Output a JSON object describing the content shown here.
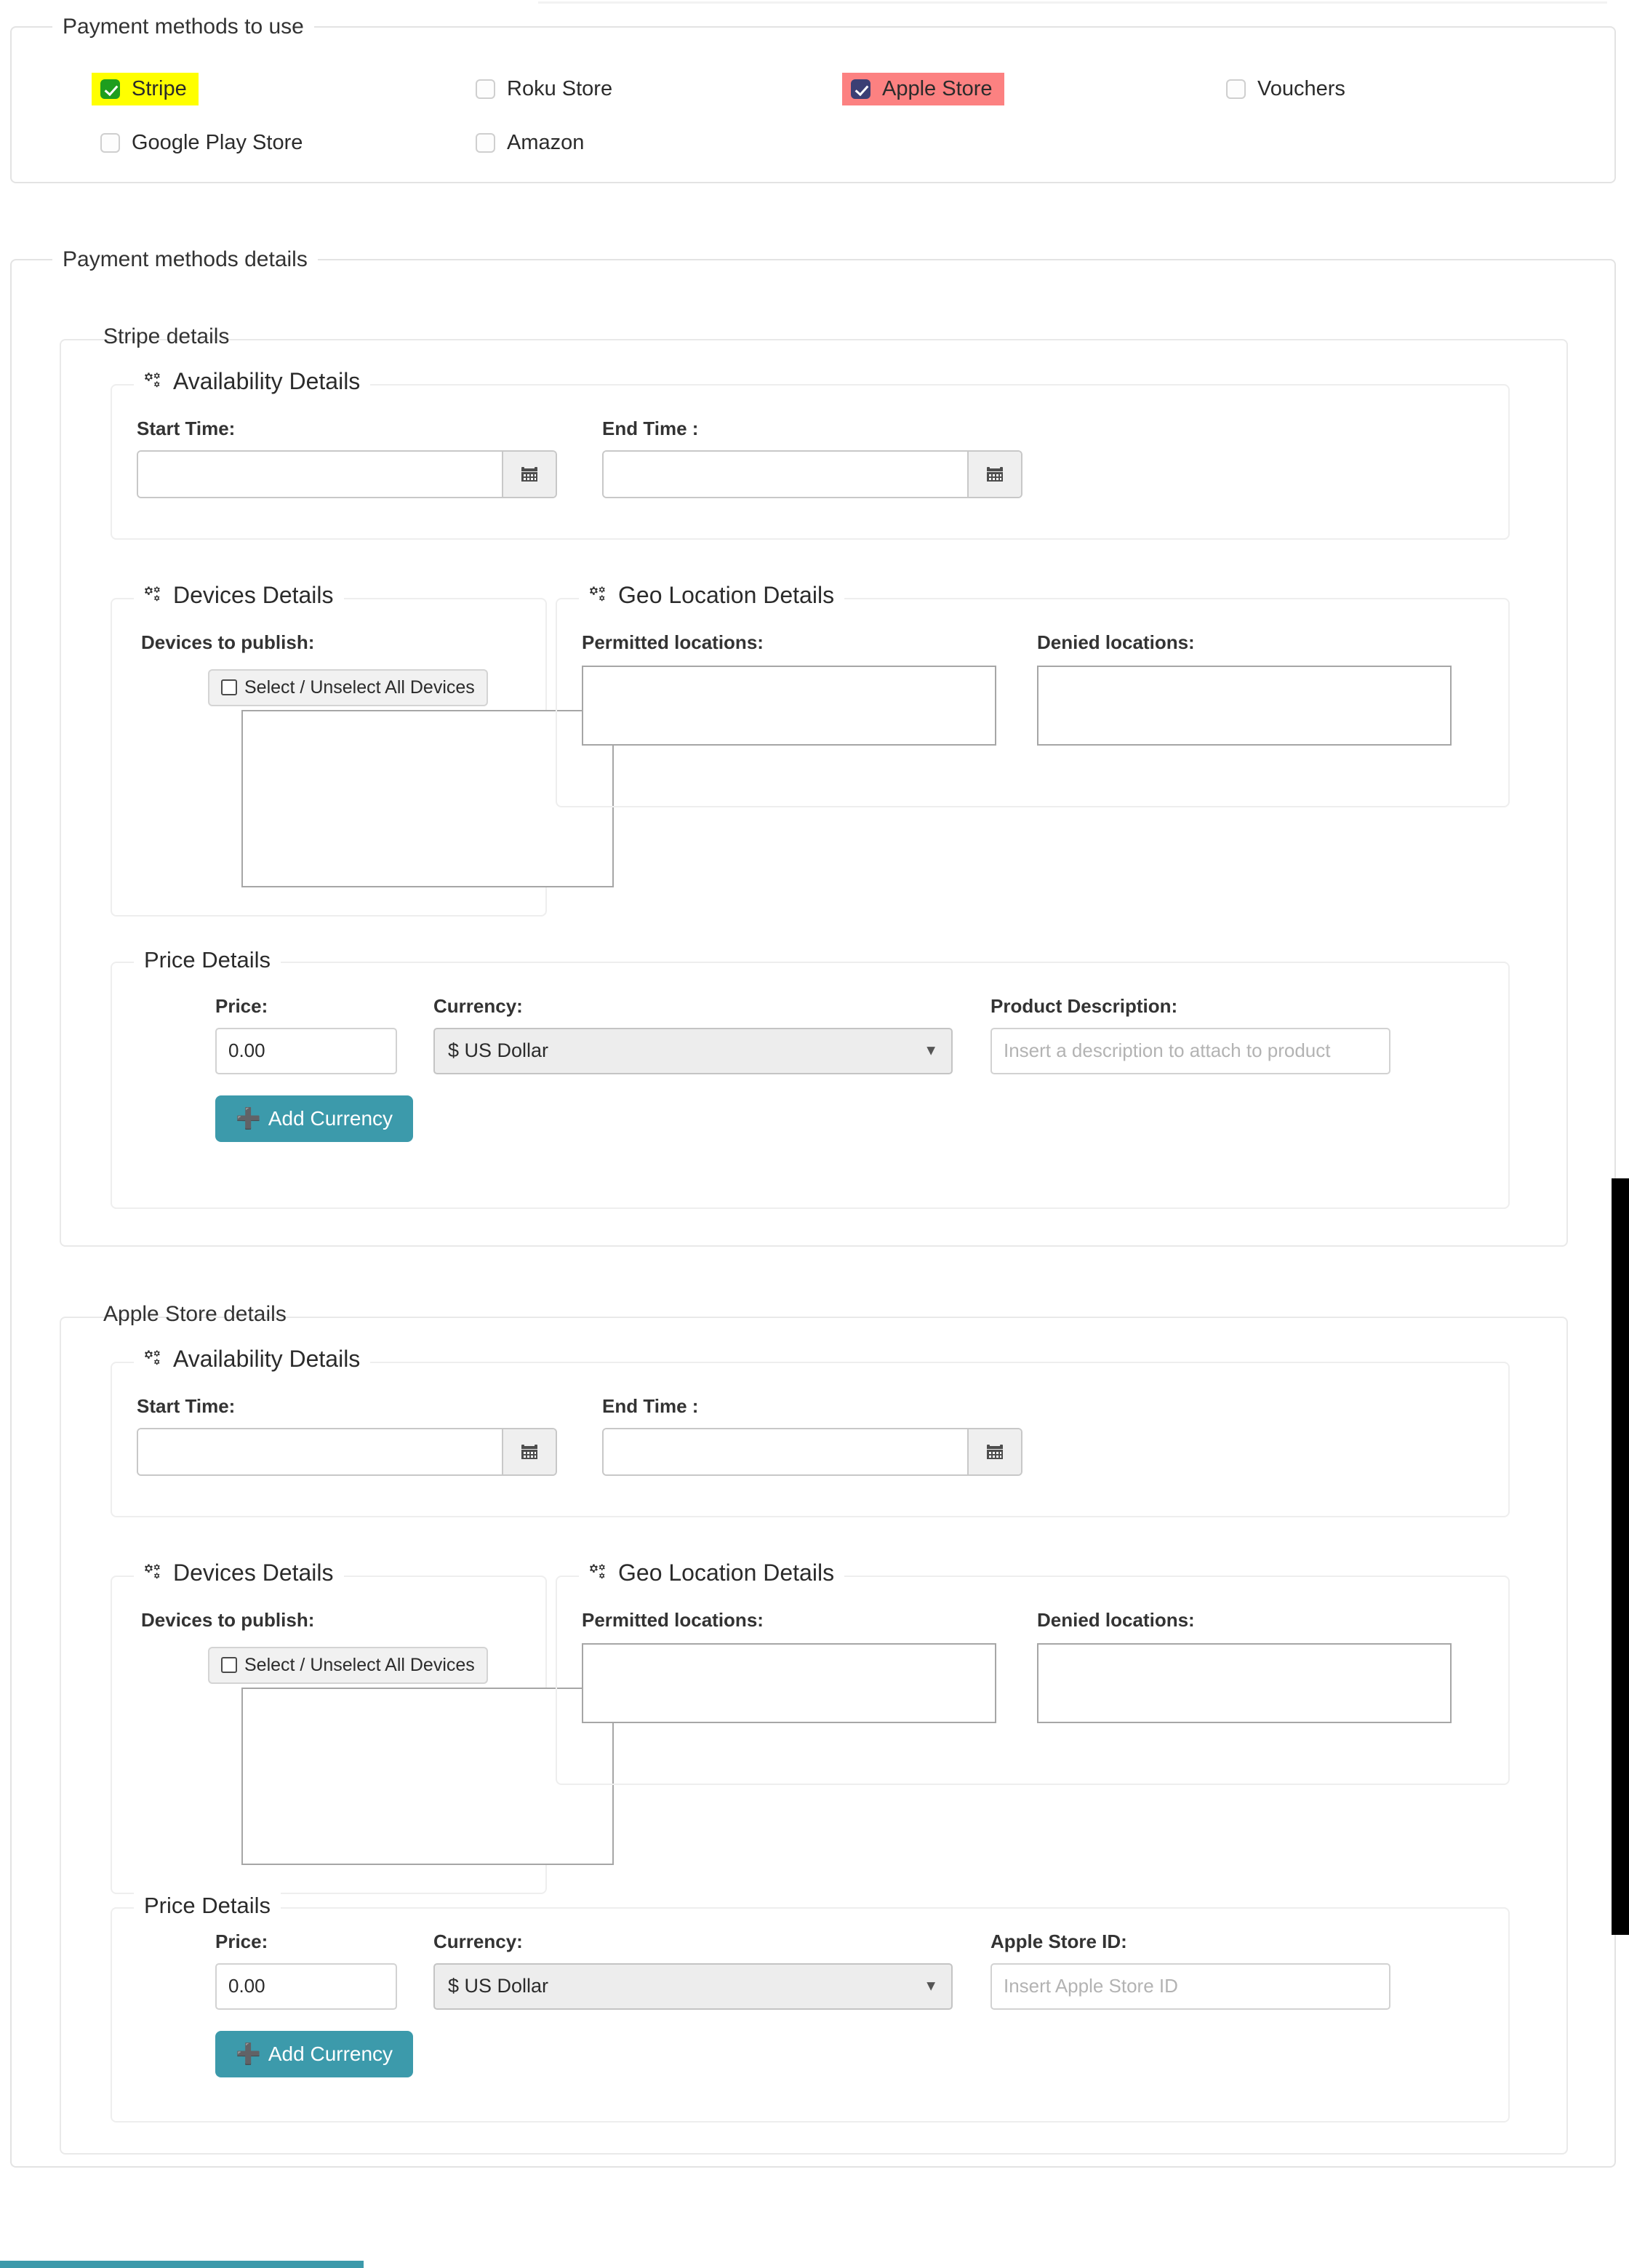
{
  "payment_methods_section": {
    "legend": "Payment methods to use",
    "methods": [
      {
        "label": "Stripe",
        "checked": true,
        "highlight": "#ffff00",
        "box_color": "#1e9e1e"
      },
      {
        "label": "Roku Store",
        "checked": false,
        "highlight": "",
        "box_color": ""
      },
      {
        "label": "Apple Store",
        "checked": true,
        "highlight": "#fc8181",
        "box_color": "#3b3f74"
      },
      {
        "label": "Vouchers",
        "checked": false,
        "highlight": "",
        "box_color": ""
      },
      {
        "label": "Google Play Store",
        "checked": false,
        "highlight": "",
        "box_color": ""
      },
      {
        "label": "Amazon",
        "checked": false,
        "highlight": "",
        "box_color": ""
      }
    ]
  },
  "details_section": {
    "legend": "Payment methods details",
    "blocks": [
      {
        "legend": "Stripe details",
        "legend_highlight": "#ffff00",
        "availability": {
          "legend": "Availability Details",
          "icon": "cogs-icon",
          "start_label": "Start Time:",
          "start_value": "",
          "end_label": "End Time :",
          "end_value": "",
          "calendar_icon": "calendar-icon"
        },
        "devices": {
          "legend": "Devices Details",
          "icon": "cogs-icon",
          "field_label": "Devices to publish:",
          "select_all_label": "Select / Unselect All Devices",
          "select_all_checked": false,
          "list_items": []
        },
        "geo": {
          "legend": "Geo Location Details",
          "icon": "cogs-icon",
          "permitted_label": "Permitted locations:",
          "denied_label": "Denied locations:",
          "permitted_items": [],
          "denied_items": []
        },
        "price": {
          "legend": "Price Details",
          "price_label": "Price:",
          "price_value": "0.00",
          "currency_label": "Currency:",
          "currency_value": "$ US Dollar",
          "third_label": "Product Description:",
          "third_placeholder": "Insert a description to attach to product",
          "third_value": "",
          "add_currency_label": "Add Currency",
          "add_currency_icon": "plus-icon",
          "add_currency_color": "#3c9aab"
        }
      },
      {
        "legend": "Apple Store details",
        "legend_highlight": "#fc8181",
        "availability": {
          "legend": "Availability Details",
          "icon": "cogs-icon",
          "start_label": "Start Time:",
          "start_value": "",
          "end_label": "End Time :",
          "end_value": "",
          "calendar_icon": "calendar-icon"
        },
        "devices": {
          "legend": "Devices Details",
          "icon": "cogs-icon",
          "field_label": "Devices to publish:",
          "select_all_label": "Select / Unselect All Devices",
          "select_all_checked": false,
          "list_items": []
        },
        "geo": {
          "legend": "Geo Location Details",
          "icon": "cogs-icon",
          "permitted_label": "Permitted locations:",
          "denied_label": "Denied locations:",
          "permitted_items": [],
          "denied_items": []
        },
        "price": {
          "legend": "Price Details",
          "price_label": "Price:",
          "price_value": "0.00",
          "currency_label": "Currency:",
          "currency_value": "$ US Dollar",
          "third_label": "Apple Store ID:",
          "third_placeholder": "Insert Apple Store ID",
          "third_value": "",
          "add_currency_label": "Add Currency",
          "add_currency_icon": "plus-icon",
          "add_currency_color": "#3c9aab"
        }
      }
    ]
  },
  "chrome": {
    "right_bar_color": "#000000",
    "bottom_bar_color": "#3c9aab"
  }
}
